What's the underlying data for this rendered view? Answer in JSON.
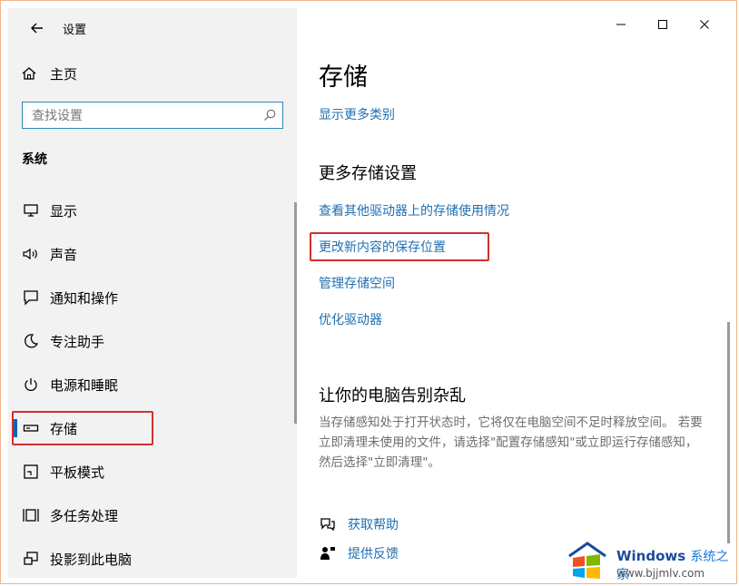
{
  "window": {
    "title": "设置",
    "controls": [
      "minimize",
      "maximize",
      "close"
    ]
  },
  "sidebar": {
    "home_label": "主页",
    "search_placeholder": "查找设置",
    "section_title": "系统",
    "items": [
      {
        "label": "显示",
        "icon": "monitor-icon"
      },
      {
        "label": "声音",
        "icon": "speaker-icon"
      },
      {
        "label": "通知和操作",
        "icon": "notification-icon"
      },
      {
        "label": "专注助手",
        "icon": "moon-icon"
      },
      {
        "label": "电源和睡眠",
        "icon": "power-icon"
      },
      {
        "label": "存储",
        "icon": "storage-icon",
        "selected": true
      },
      {
        "label": "平板模式",
        "icon": "tablet-icon"
      },
      {
        "label": "多任务处理",
        "icon": "multitask-icon"
      },
      {
        "label": "投影到此电脑",
        "icon": "project-icon"
      }
    ]
  },
  "main": {
    "title": "存储",
    "show_more_link": "显示更多类别",
    "more_settings_heading": "更多存储设置",
    "links": [
      "查看其他驱动器上的存储使用情况",
      "更改新内容的保存位置",
      "管理存储空间",
      "优化驱动器"
    ],
    "clutter_heading": "让你的电脑告别杂乱",
    "clutter_text": "当存储感知处于打开状态时，它将仅在电脑空间不足时释放空间。 若要立即清理未使用的文件，请选择\"配置存储感知\"或立即运行存储感知，然后选择\"立即清理\"。",
    "help_label": "获取帮助",
    "feedback_label": "提供反馈"
  },
  "watermark": {
    "brand": "Windows",
    "brand_suffix": "系统之家",
    "url": "www.bjjmlv.com"
  },
  "colors": {
    "accent": "#0067b8",
    "link": "#1f6fb2",
    "highlight": "#d32f2f"
  }
}
